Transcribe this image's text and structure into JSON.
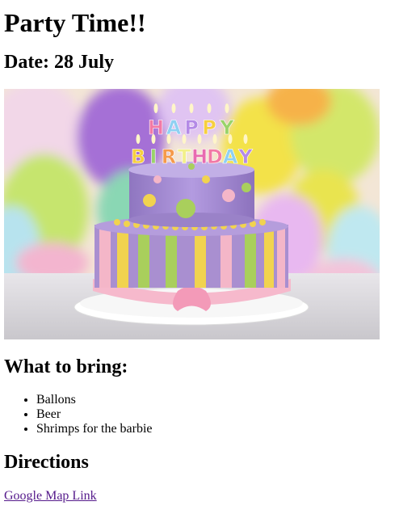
{
  "page": {
    "title": "Party Time!!",
    "date": "Date: 28 July",
    "hero_image": {
      "candle_letters_top": [
        "H",
        "A",
        "P",
        "P",
        "Y"
      ],
      "candle_letters_bottom": [
        "B",
        "I",
        "R",
        "T",
        "H",
        "D",
        "A",
        "Y"
      ]
    },
    "bring_heading": "What to bring:",
    "bring_items": [
      "Ballons",
      "Beer",
      "Shrimps for the barbie"
    ],
    "directions_heading": "Directions",
    "map_link_text": "Google Map Link"
  },
  "colors": {
    "link_visited": "#551a8b",
    "cake_purple": "#a98fd0",
    "cake_pink": "#f4b6c8",
    "cake_yellow": "#f1d34f",
    "cake_green": "#a9cf5c"
  }
}
